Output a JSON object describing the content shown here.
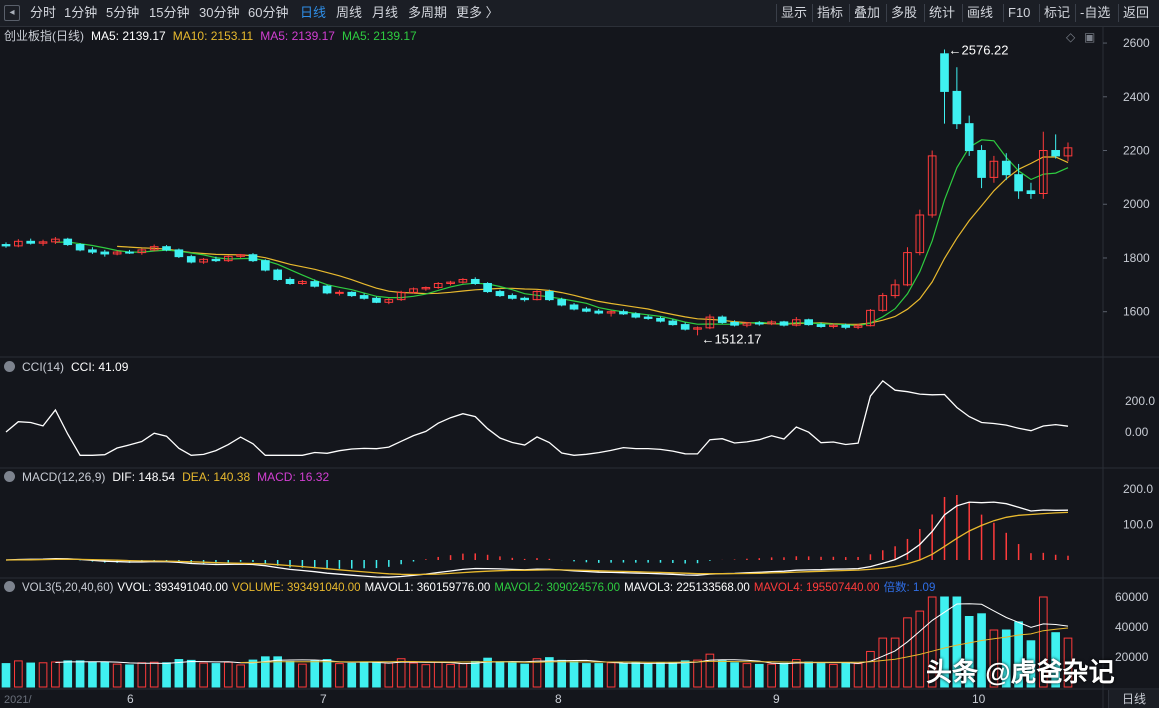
{
  "toolbar": {
    "periods": [
      "分时",
      "1分钟",
      "5分钟",
      "15分钟",
      "30分钟",
      "60分钟",
      "日线",
      "周线",
      "月线",
      "多周期",
      "更多 〉"
    ],
    "active_period": "日线",
    "tools": [
      "显示",
      "指标",
      "叠加",
      "多股",
      "统计",
      "画线",
      "F10",
      "标记",
      "-自选",
      "返回"
    ]
  },
  "colors": {
    "bg": "#14161c",
    "up": "#ff3b3b",
    "down": "#3ff0f0",
    "ma5": "#ffffff",
    "ma10": "#e8b92e",
    "ma_green": "#2ecc40",
    "magenta": "#d23fd2"
  },
  "price_pane": {
    "legend": {
      "name": "创业板指(日线)",
      "ma5": "MA5: 2139.17",
      "ma10": "MA10: 2153.11",
      "ma5b": "MA5: 2139.17",
      "ma5c": "MA5: 2139.17"
    },
    "high_label": "2576.22",
    "low_label": "1512.17",
    "yticks": [
      "2600",
      "2400",
      "2200",
      "2000",
      "1800",
      "1600"
    ],
    "ylim": [
      1450,
      2630
    ]
  },
  "cci_pane": {
    "legend": {
      "name": "CCI(14)",
      "value": "CCI: 41.09"
    },
    "yticks": [
      "200.0",
      "0.00"
    ]
  },
  "macd_pane": {
    "legend": {
      "name": "MACD(12,26,9)",
      "dif": "DIF: 148.54",
      "dea": "DEA: 140.38",
      "macd": "MACD: 16.32"
    },
    "yticks": [
      "200.0",
      "100.0"
    ]
  },
  "vol_pane": {
    "legend": {
      "name": "VOL3(5,20,40,60)",
      "vvol": "VVOL: 393491040.00",
      "volume": "VOLUME: 393491040.00",
      "mavol1": "MAVOL1: 360159776.00",
      "mavol2": "MAVOL2: 309024576.00",
      "mavol3": "MAVOL3: 225133568.00",
      "mavol4": "MAVOL4: 195507440.00",
      "ratio": "倍数: 1.09"
    },
    "yticks": [
      "60000",
      "40000",
      "20000"
    ]
  },
  "x_axis": {
    "labels": [
      "6",
      "7",
      "8",
      "9",
      "10"
    ],
    "period_tag": "日线",
    "first_label": "2021/"
  },
  "watermark": "头条 @虎爸杂记",
  "chart_data": {
    "type": "candlestick",
    "ohlc": [
      [
        1850,
        1858,
        1838,
        1845
      ],
      [
        1845,
        1870,
        1840,
        1862
      ],
      [
        1862,
        1872,
        1850,
        1855
      ],
      [
        1855,
        1868,
        1845,
        1860
      ],
      [
        1860,
        1878,
        1852,
        1870
      ],
      [
        1870,
        1875,
        1845,
        1850
      ],
      [
        1850,
        1855,
        1825,
        1830
      ],
      [
        1830,
        1840,
        1815,
        1822
      ],
      [
        1822,
        1830,
        1805,
        1815
      ],
      [
        1815,
        1828,
        1810,
        1822
      ],
      [
        1822,
        1830,
        1815,
        1820
      ],
      [
        1820,
        1835,
        1812,
        1830
      ],
      [
        1830,
        1850,
        1825,
        1842
      ],
      [
        1842,
        1848,
        1825,
        1830
      ],
      [
        1830,
        1835,
        1800,
        1805
      ],
      [
        1805,
        1812,
        1780,
        1785
      ],
      [
        1785,
        1800,
        1778,
        1795
      ],
      [
        1795,
        1805,
        1785,
        1790
      ],
      [
        1790,
        1810,
        1785,
        1806
      ],
      [
        1806,
        1815,
        1800,
        1812
      ],
      [
        1812,
        1818,
        1785,
        1790
      ],
      [
        1790,
        1795,
        1750,
        1755
      ],
      [
        1755,
        1760,
        1715,
        1720
      ],
      [
        1720,
        1728,
        1700,
        1705
      ],
      [
        1705,
        1718,
        1700,
        1712
      ],
      [
        1712,
        1720,
        1690,
        1695
      ],
      [
        1695,
        1700,
        1665,
        1670
      ],
      [
        1670,
        1680,
        1660,
        1672
      ],
      [
        1672,
        1676,
        1655,
        1660
      ],
      [
        1660,
        1668,
        1645,
        1650
      ],
      [
        1650,
        1656,
        1632,
        1635
      ],
      [
        1635,
        1650,
        1628,
        1645
      ],
      [
        1645,
        1678,
        1640,
        1672
      ],
      [
        1672,
        1690,
        1668,
        1685
      ],
      [
        1685,
        1694,
        1678,
        1690
      ],
      [
        1690,
        1710,
        1685,
        1705
      ],
      [
        1705,
        1715,
        1698,
        1710
      ],
      [
        1710,
        1725,
        1705,
        1720
      ],
      [
        1720,
        1728,
        1700,
        1705
      ],
      [
        1705,
        1710,
        1670,
        1675
      ],
      [
        1675,
        1682,
        1655,
        1660
      ],
      [
        1660,
        1668,
        1645,
        1650
      ],
      [
        1650,
        1656,
        1638,
        1645
      ],
      [
        1645,
        1680,
        1642,
        1675
      ],
      [
        1675,
        1682,
        1640,
        1645
      ],
      [
        1645,
        1652,
        1620,
        1625
      ],
      [
        1625,
        1632,
        1605,
        1610
      ],
      [
        1610,
        1618,
        1598,
        1602
      ],
      [
        1602,
        1610,
        1590,
        1595
      ],
      [
        1595,
        1605,
        1582,
        1600
      ],
      [
        1600,
        1608,
        1588,
        1592
      ],
      [
        1592,
        1598,
        1575,
        1580
      ],
      [
        1580,
        1588,
        1570,
        1575
      ],
      [
        1575,
        1582,
        1560,
        1565
      ],
      [
        1565,
        1572,
        1548,
        1552
      ],
      [
        1552,
        1560,
        1530,
        1535
      ],
      [
        1535,
        1545,
        1512,
        1540
      ],
      [
        1540,
        1590,
        1535,
        1580
      ],
      [
        1580,
        1586,
        1555,
        1560
      ],
      [
        1560,
        1568,
        1545,
        1550
      ],
      [
        1550,
        1562,
        1542,
        1558
      ],
      [
        1558,
        1565,
        1548,
        1555
      ],
      [
        1555,
        1568,
        1550,
        1562
      ],
      [
        1562,
        1566,
        1545,
        1550
      ],
      [
        1550,
        1580,
        1545,
        1570
      ],
      [
        1570,
        1574,
        1548,
        1552
      ],
      [
        1552,
        1560,
        1540,
        1545
      ],
      [
        1545,
        1555,
        1538,
        1550
      ],
      [
        1550,
        1556,
        1535,
        1542
      ],
      [
        1542,
        1555,
        1535,
        1548
      ],
      [
        1548,
        1610,
        1545,
        1605
      ],
      [
        1605,
        1670,
        1600,
        1660
      ],
      [
        1660,
        1720,
        1650,
        1700
      ],
      [
        1700,
        1840,
        1695,
        1820
      ],
      [
        1820,
        1980,
        1810,
        1960
      ],
      [
        1960,
        2200,
        1950,
        2180
      ],
      [
        2560,
        2576,
        2300,
        2420
      ],
      [
        2420,
        2510,
        2280,
        2300
      ],
      [
        2300,
        2330,
        2180,
        2200
      ],
      [
        2200,
        2220,
        2060,
        2100
      ],
      [
        2100,
        2180,
        2080,
        2160
      ],
      [
        2160,
        2190,
        2090,
        2110
      ],
      [
        2110,
        2150,
        2020,
        2050
      ],
      [
        2050,
        2080,
        2020,
        2040
      ],
      [
        2040,
        2270,
        2020,
        2200
      ],
      [
        2200,
        2260,
        2170,
        2180
      ],
      [
        2180,
        2230,
        2160,
        2210
      ]
    ]
  }
}
